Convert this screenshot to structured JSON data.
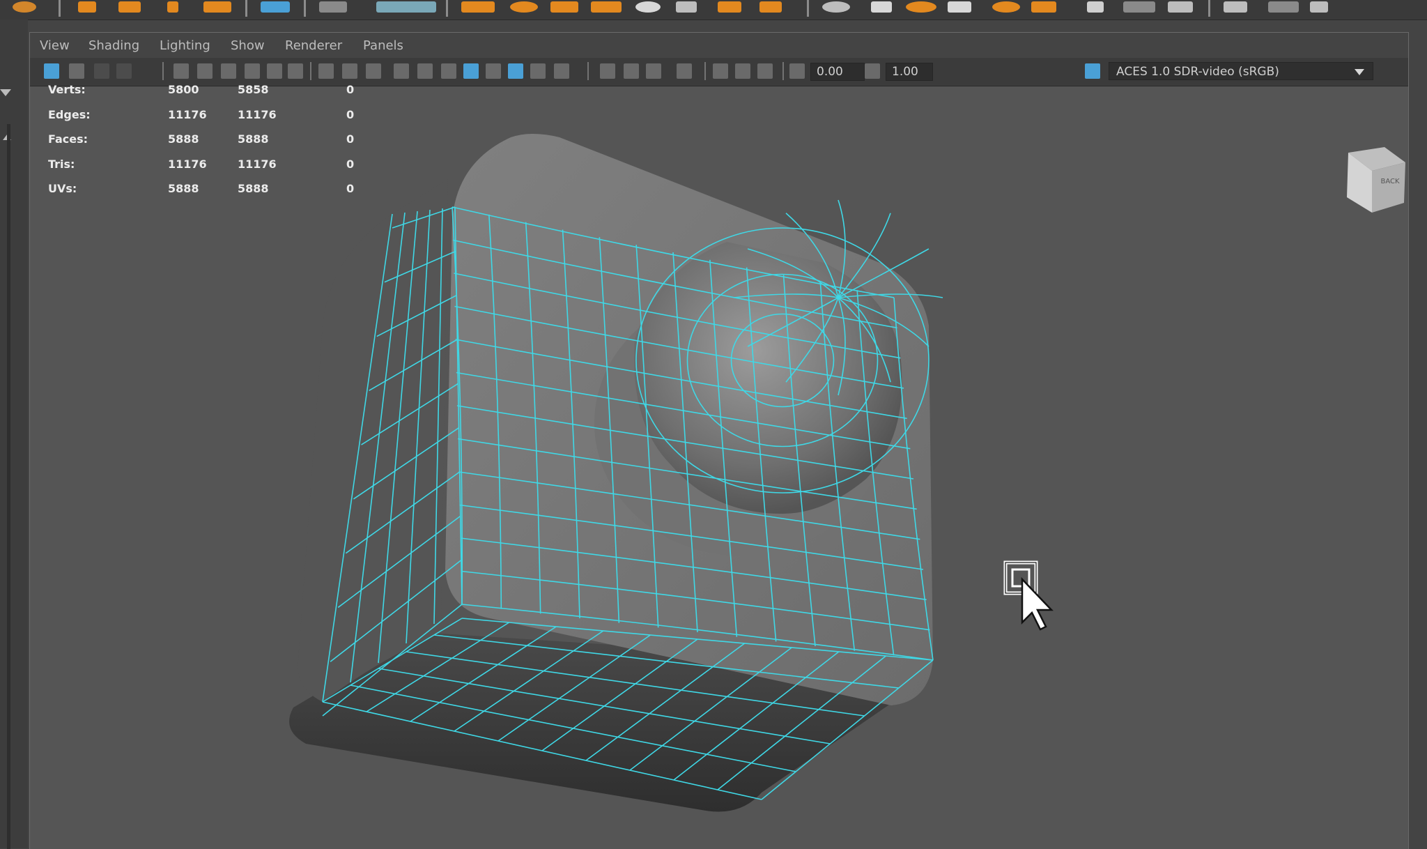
{
  "menus": [
    "View",
    "Shading",
    "Lighting",
    "Show",
    "Renderer",
    "Panels"
  ],
  "toolbar": {
    "exposure": "0.00",
    "gamma": "1.00",
    "color_space": "ACES 1.0 SDR-video (sRGB)"
  },
  "hud": {
    "rows": [
      {
        "label": "Verts:",
        "a": "5800",
        "b": "5858",
        "c": "0"
      },
      {
        "label": "Edges:",
        "a": "11176",
        "b": "11176",
        "c": "0"
      },
      {
        "label": "Faces:",
        "a": "5888",
        "b": "5888",
        "c": "0"
      },
      {
        "label": "Tris:",
        "a": "11176",
        "b": "11176",
        "c": "0"
      },
      {
        "label": "UVs:",
        "a": "5888",
        "b": "5888",
        "c": "0"
      }
    ]
  },
  "viewcube": {
    "face_label": "BACK"
  },
  "colors": {
    "wireframe": "#3fd8e6",
    "viewport_bg": "#555555",
    "active_icon": "#4aa0d6",
    "shelf_icon": "#e3891f"
  },
  "icons": {
    "cursor": "arrow-cursor-icon",
    "selection": "select-box-icon"
  }
}
